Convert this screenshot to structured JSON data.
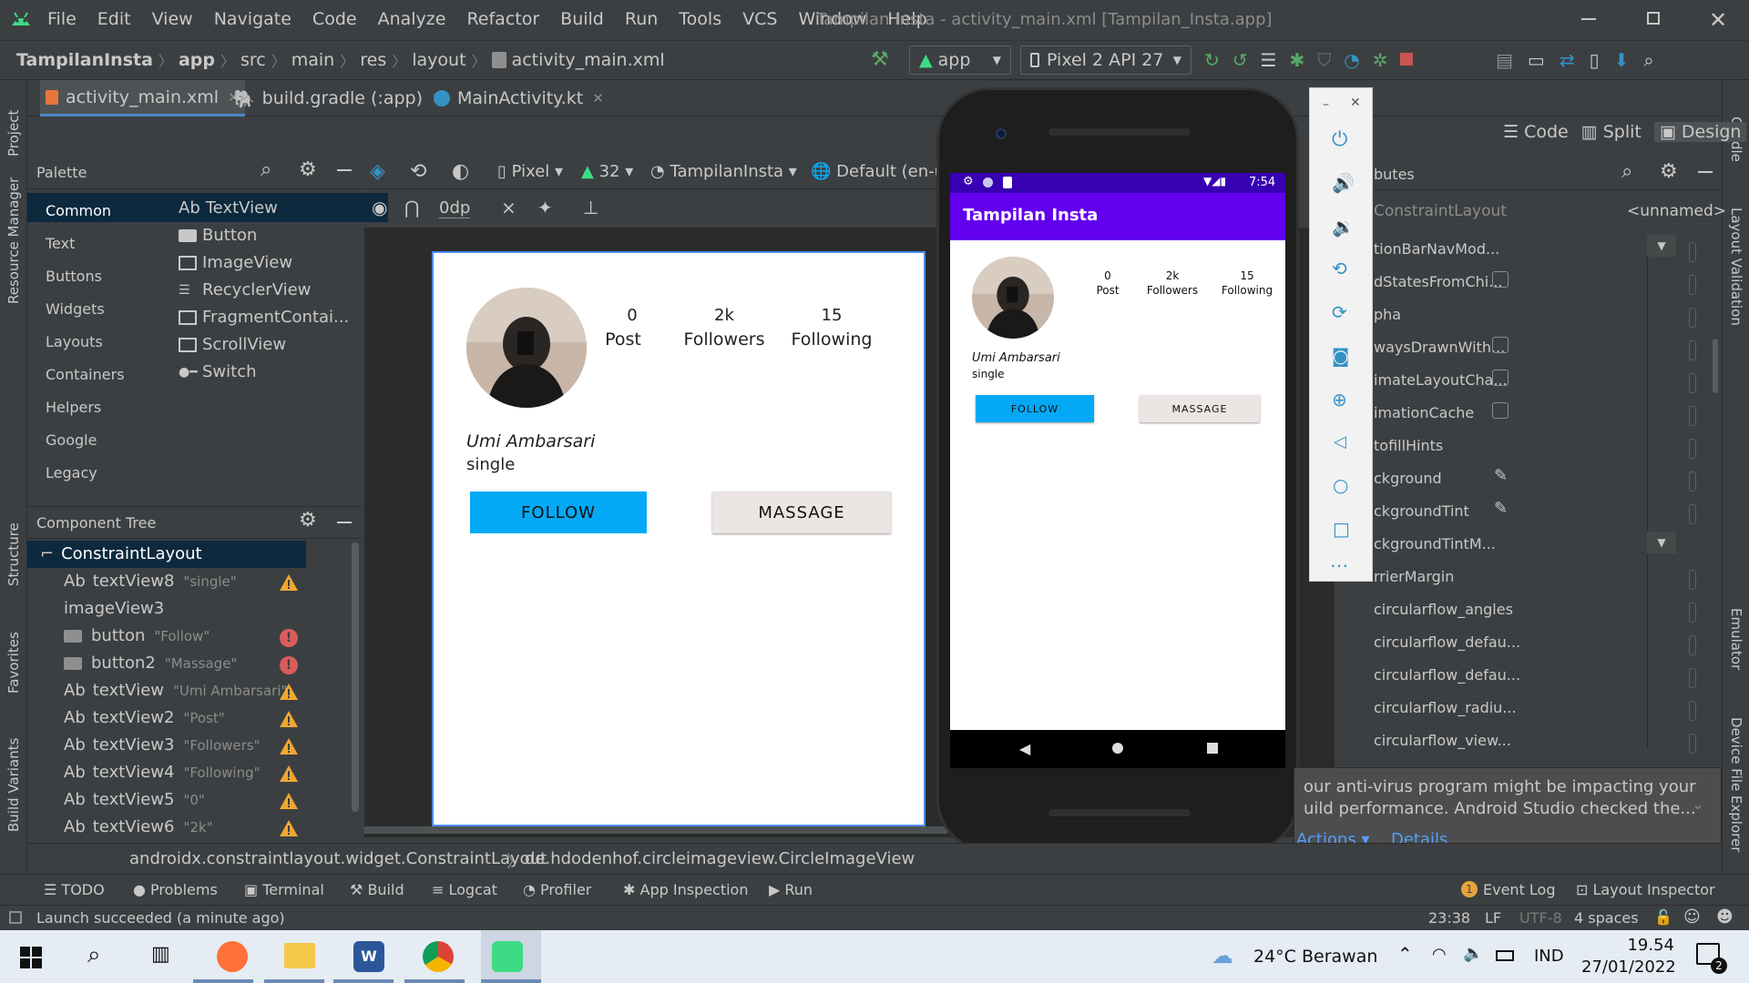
{
  "window": {
    "title": "Tampilan Insta - activity_main.xml [Tampilan_Insta.app]",
    "menu": [
      "File",
      "Edit",
      "View",
      "Navigate",
      "Code",
      "Analyze",
      "Refactor",
      "Build",
      "Run",
      "Tools",
      "VCS",
      "Window",
      "Help"
    ]
  },
  "breadcrumb": [
    "TampilanInsta",
    "app",
    "src",
    "main",
    "res",
    "layout",
    "activity_main.xml"
  ],
  "toolbar": {
    "module": "app",
    "device": "Pixel 2 API 27"
  },
  "editor_tabs": [
    "activity_main.xml",
    "build.gradle (:app)",
    "MainActivity.kt"
  ],
  "view_modes": {
    "code": "Code",
    "split": "Split",
    "design": "Design"
  },
  "palette": {
    "title": "Palette",
    "categories": [
      "Common",
      "Text",
      "Buttons",
      "Widgets",
      "Layouts",
      "Containers",
      "Helpers",
      "Google",
      "Legacy"
    ],
    "items": [
      {
        "icon": "Ab",
        "label": "TextView"
      },
      {
        "icon": "button-widget-icon",
        "label": "Button"
      },
      {
        "icon": "image-widget-icon",
        "label": "ImageView"
      },
      {
        "icon": "list-widget-icon",
        "label": "RecyclerView"
      },
      {
        "icon": "fragment-widget-icon",
        "label": "FragmentContai..."
      },
      {
        "icon": "scroll-widget-icon",
        "label": "ScrollView"
      },
      {
        "icon": "switch-widget-icon",
        "label": "Switch"
      }
    ]
  },
  "design_toolbar": {
    "device": "Pixel",
    "api": "32",
    "theme": "TampilanInsta",
    "locale": "Default (en-us",
    "margin": "0dp"
  },
  "component_tree": {
    "title": "Component Tree",
    "root": "ConstraintLayout",
    "nodes": [
      {
        "prefix": "Ab",
        "id": "textView8",
        "text": "\"single\"",
        "status": "warning"
      },
      {
        "prefix": "",
        "id": "imageView3",
        "text": "",
        "status": ""
      },
      {
        "prefix": "",
        "id": "button",
        "text": "\"Follow\"",
        "status": "error"
      },
      {
        "prefix": "",
        "id": "button2",
        "text": "\"Massage\"",
        "status": "error"
      },
      {
        "prefix": "Ab",
        "id": "textView",
        "text": "\"Umi Ambarsari\"",
        "status": "warning"
      },
      {
        "prefix": "Ab",
        "id": "textView2",
        "text": "\"Post\"",
        "status": "warning"
      },
      {
        "prefix": "Ab",
        "id": "textView3",
        "text": "\"Followers\"",
        "status": "warning"
      },
      {
        "prefix": "Ab",
        "id": "textView4",
        "text": "\"Following\"",
        "status": "warning"
      },
      {
        "prefix": "Ab",
        "id": "textView5",
        "text": "\"0\"",
        "status": "warning"
      },
      {
        "prefix": "Ab",
        "id": "textView6",
        "text": "\"2k\"",
        "status": "warning"
      }
    ]
  },
  "profile": {
    "stats": [
      {
        "value": "0",
        "label": "Post"
      },
      {
        "value": "2k",
        "label": "Followers"
      },
      {
        "value": "15",
        "label": "Following"
      }
    ],
    "name": "Umi Ambarsari",
    "status": "single",
    "follow_label": "FOLLOW",
    "massage_label": "MASSAGE"
  },
  "emulator": {
    "clock": "7:54",
    "app_title": "Tampilan Insta",
    "appbar_color": "#6200ee",
    "statusbar_color": "#3700b3",
    "follow_color": "#03a9f4"
  },
  "attributes": {
    "title": "butes",
    "header_left": "ConstraintLayout",
    "header_right": "<unnamed>",
    "rows": [
      "tionBarNavMod...",
      "dStatesFromChi...",
      "pha",
      "waysDrawnWith...",
      "imateLayoutCha...",
      "imationCache",
      "tofillHints",
      "ckground",
      "ckgroundTint",
      "ckgroundTintM...",
      "rrierMargin",
      "circularflow_angles",
      "circularflow_defau...",
      "circularflow_defau...",
      "circularflow_radiu...",
      "circularflow_view..."
    ]
  },
  "notification": {
    "line1": "our anti-virus program might be impacting your",
    "line2": "uild performance. Android Studio checked the...",
    "actions": "Actions",
    "details": "Details"
  },
  "path_bar": [
    "androidx.constraintlayout.widget.ConstraintLayout",
    "de.hdodenhof.circleimageview.CircleImageView"
  ],
  "tool_windows": [
    "TODO",
    "Problems",
    "Terminal",
    "Build",
    "Logcat",
    "Profiler",
    "App Inspection",
    "Run"
  ],
  "tool_windows_right": [
    "Event Log",
    "Layout Inspector"
  ],
  "side_labels_left": [
    "Project",
    "Resource Manager",
    "Structure",
    "Favorites",
    "Build Variants"
  ],
  "side_labels_right": [
    "Gradle",
    "Layout Validation",
    "Emulator",
    "Device File Explorer"
  ],
  "status": {
    "message": "Launch succeeded (a minute ago)",
    "position": "23:38",
    "line_sep": "LF",
    "encoding": "UTF-8",
    "indent": "4 spaces"
  },
  "event_badge": "1",
  "taskbar": {
    "weather": "24°C  Berawan",
    "lang": "IND",
    "time": "19.54",
    "date": "27/01/2022",
    "notif_count": "2"
  }
}
